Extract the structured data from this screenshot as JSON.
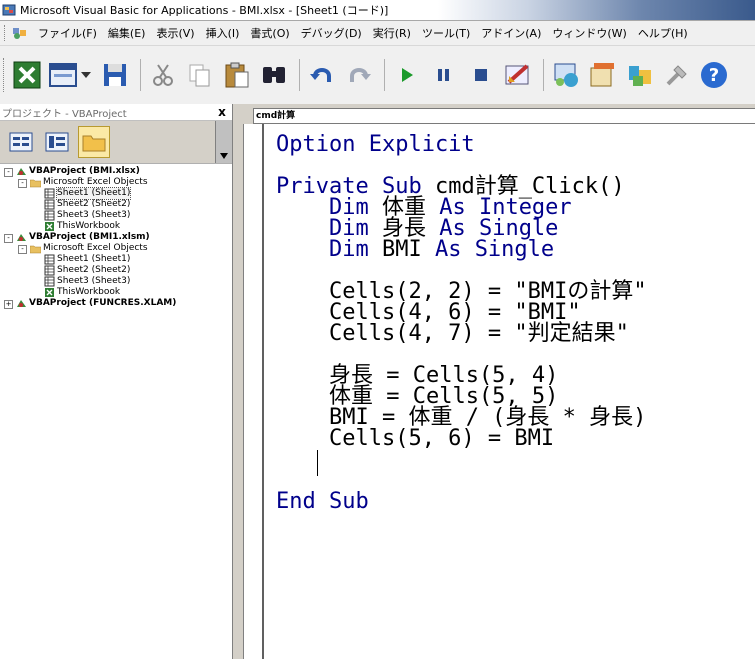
{
  "window": {
    "title": "Microsoft Visual Basic for Applications - BMI.xlsx - [Sheet1 (コード)]"
  },
  "menu": [
    "ファイル(F)",
    "編集(E)",
    "表示(V)",
    "挿入(I)",
    "書式(O)",
    "デバッグ(D)",
    "実行(R)",
    "ツール(T)",
    "アドイン(A)",
    "ウィンドウ(W)",
    "ヘルプ(H)"
  ],
  "toolbar": {
    "icons": [
      "excel-icon",
      "insert-userform-icon",
      "save-icon",
      "cut-icon",
      "copy-icon",
      "paste-icon",
      "find-icon",
      "undo-icon",
      "redo-icon",
      "run-icon",
      "break-icon",
      "reset-icon",
      "design-mode-icon",
      "project-explorer-icon",
      "properties-icon",
      "object-browser-icon",
      "toolbox-icon",
      "help-icon"
    ]
  },
  "project_panel": {
    "title": "プロジェクト - VBAProject",
    "close_label": "x",
    "tree": [
      {
        "level": 0,
        "expander": "-",
        "icon": "vbaproject-icon",
        "label": "VBAProject (BMI.xlsx)",
        "bold": true
      },
      {
        "level": 1,
        "expander": "-",
        "icon": "folder-icon",
        "label": "Microsoft Excel Objects",
        "bold": false
      },
      {
        "level": 2,
        "expander": "",
        "icon": "sheet-icon",
        "label": "Sheet1 (Sheet1)",
        "bold": false,
        "selected": true
      },
      {
        "level": 2,
        "expander": "",
        "icon": "sheet-icon",
        "label": "Sheet2 (Sheet2)",
        "bold": false
      },
      {
        "level": 2,
        "expander": "",
        "icon": "sheet-icon",
        "label": "Sheet3 (Sheet3)",
        "bold": false
      },
      {
        "level": 2,
        "expander": "",
        "icon": "workbook-icon",
        "label": "ThisWorkbook",
        "bold": false
      },
      {
        "level": 0,
        "expander": "-",
        "icon": "vbaproject-icon",
        "label": "VBAProject (BMI1.xlsm)",
        "bold": true
      },
      {
        "level": 1,
        "expander": "-",
        "icon": "folder-icon",
        "label": "Microsoft Excel Objects",
        "bold": false
      },
      {
        "level": 2,
        "expander": "",
        "icon": "sheet-icon",
        "label": "Sheet1 (Sheet1)",
        "bold": false
      },
      {
        "level": 2,
        "expander": "",
        "icon": "sheet-icon",
        "label": "Sheet2 (Sheet2)",
        "bold": false
      },
      {
        "level": 2,
        "expander": "",
        "icon": "sheet-icon",
        "label": "Sheet3 (Sheet3)",
        "bold": false
      },
      {
        "level": 2,
        "expander": "",
        "icon": "workbook-icon",
        "label": "ThisWorkbook",
        "bold": false
      },
      {
        "level": 0,
        "expander": "+",
        "icon": "vbaproject-icon",
        "label": "VBAProject (FUNCRES.XLAM)",
        "bold": true
      }
    ]
  },
  "code_window": {
    "object_combo": "cmd計算",
    "lines": [
      [
        {
          "t": "Option Explicit",
          "k": true
        }
      ],
      [],
      [
        {
          "t": "Private Sub ",
          "k": true
        },
        {
          "t": "cmd計算_Click()",
          "k": false
        }
      ],
      [
        {
          "t": "    Dim ",
          "k": true
        },
        {
          "t": "体重 ",
          "k": false
        },
        {
          "t": "As Integer",
          "k": true
        }
      ],
      [
        {
          "t": "    Dim ",
          "k": true
        },
        {
          "t": "身長 ",
          "k": false
        },
        {
          "t": "As Single",
          "k": true
        }
      ],
      [
        {
          "t": "    Dim ",
          "k": true
        },
        {
          "t": "BMI ",
          "k": false
        },
        {
          "t": "As Single",
          "k": true
        }
      ],
      [],
      [
        {
          "t": "    Cells(2, 2) = \"BMIの計算\"",
          "k": false
        }
      ],
      [
        {
          "t": "    Cells(4, 6) = \"BMI\"",
          "k": false
        }
      ],
      [
        {
          "t": "    Cells(4, 7) = \"判定結果\"",
          "k": false
        }
      ],
      [],
      [
        {
          "t": "    身長 = Cells(5, 4)",
          "k": false
        }
      ],
      [
        {
          "t": "    体重 = Cells(5, 5)",
          "k": false
        }
      ],
      [
        {
          "t": "    BMI = 体重 / (身長 * 身長)",
          "k": false
        }
      ],
      [
        {
          "t": "    Cells(5, 6) = BMI",
          "k": false
        }
      ],
      [],
      [],
      [
        {
          "t": "End Sub",
          "k": true
        }
      ]
    ]
  },
  "colors": {
    "keyword": "#00008b",
    "text": "#000000",
    "panel_bg": "#d4d0c8"
  }
}
